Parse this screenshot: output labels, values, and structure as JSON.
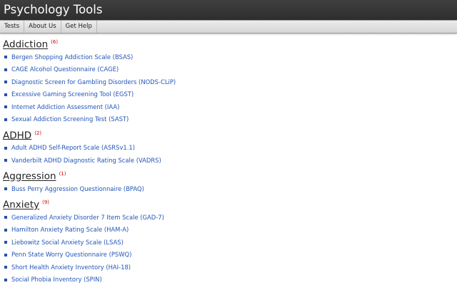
{
  "header": {
    "title": "Psychology Tools"
  },
  "nav": {
    "items": [
      "Tests",
      "About Us",
      "Get Help"
    ]
  },
  "sections": [
    {
      "title": "Addiction",
      "count": "(6)",
      "items": [
        "Bergen Shopping Addiction Scale (BSAS)",
        "CAGE Alcohol Questionnaire (CAGE)",
        "Diagnostic Screen for Gambling Disorders (NODS-CLiP)",
        "Excessive Gaming Screening Tool (EGST)",
        "Internet Addiction Assessment (IAA)",
        "Sexual Addiction Screening Test (SAST)"
      ]
    },
    {
      "title": "ADHD",
      "count": "(2)",
      "items": [
        "Adult ADHD Self-Report Scale (ASRSv1.1)",
        "Vanderbilt ADHD Diagnostic Rating Scale (VADRS)"
      ]
    },
    {
      "title": "Aggression",
      "count": "(1)",
      "items": [
        "Buss Perry Aggression Questionnaire (BPAQ)"
      ]
    },
    {
      "title": "Anxiety",
      "count": "(9)",
      "items": [
        "Generalized Anxiety Disorder 7 Item Scale (GAD-7)",
        "Hamilton Anxiety Rating Scale (HAM-A)",
        "Liebowitz Social Anxiety Scale (LSAS)",
        "Penn State Worry Questionnaire (PSWQ)",
        "Short Health Anxiety Inventory (HAI-18)",
        "Social Phobia Inventory (SPIN)"
      ]
    }
  ]
}
